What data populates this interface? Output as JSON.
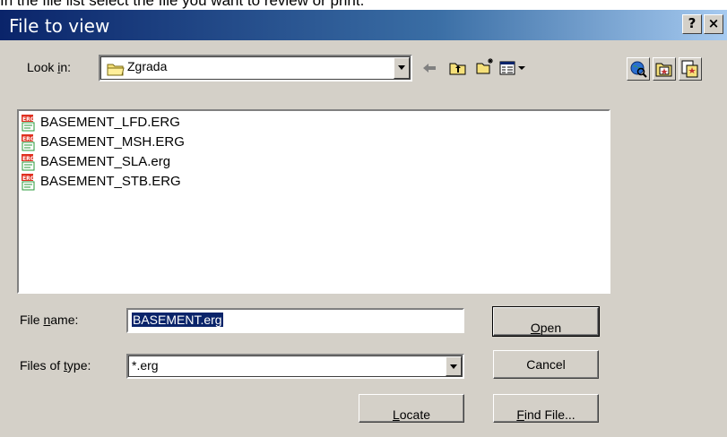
{
  "instruction": "In the file list select the file you want to review or print.",
  "window": {
    "title": "File to view",
    "help_label": "?",
    "close_label": "×"
  },
  "look_in": {
    "label_prefix": "Look ",
    "label_accel": "i",
    "label_suffix": "n:",
    "value": "Zgrada"
  },
  "files": [
    {
      "name": "BASEMENT_LFD.ERG"
    },
    {
      "name": "BASEMENT_MSH.ERG"
    },
    {
      "name": "BASEMENT_SLA.erg"
    },
    {
      "name": "BASEMENT_STB.ERG"
    }
  ],
  "file_name": {
    "label_prefix": "File ",
    "label_accel": "n",
    "label_suffix": "ame:",
    "value": "BASEMENT.erg"
  },
  "file_type": {
    "label_prefix": "Files of ",
    "label_accel": "t",
    "label_suffix": "ype:",
    "value": "*.erg"
  },
  "buttons": {
    "open_accel": "O",
    "open_rest": "pen",
    "cancel": "Cancel",
    "locate_accel": "L",
    "locate_rest": "ocate",
    "find_accel": "F",
    "find_rest": "ind File..."
  },
  "colors": {
    "title_gradient_start": "#0a246a",
    "title_gradient_end": "#a6caf0",
    "dialog_face": "#d4d0c8",
    "selection": "#0a246a",
    "file_icon_red": "#e03020",
    "file_icon_green": "#2a9a3a"
  },
  "icons": {
    "folder": "folder-icon",
    "back": "back-arrow-icon",
    "up": "up-folder-icon",
    "new_folder": "new-folder-icon",
    "view_menu": "view-menu-icon",
    "globe": "globe-search-icon",
    "star_folder": "star-folder-icon",
    "star_copy": "star-copy-icon",
    "file": "erg-file-icon"
  }
}
